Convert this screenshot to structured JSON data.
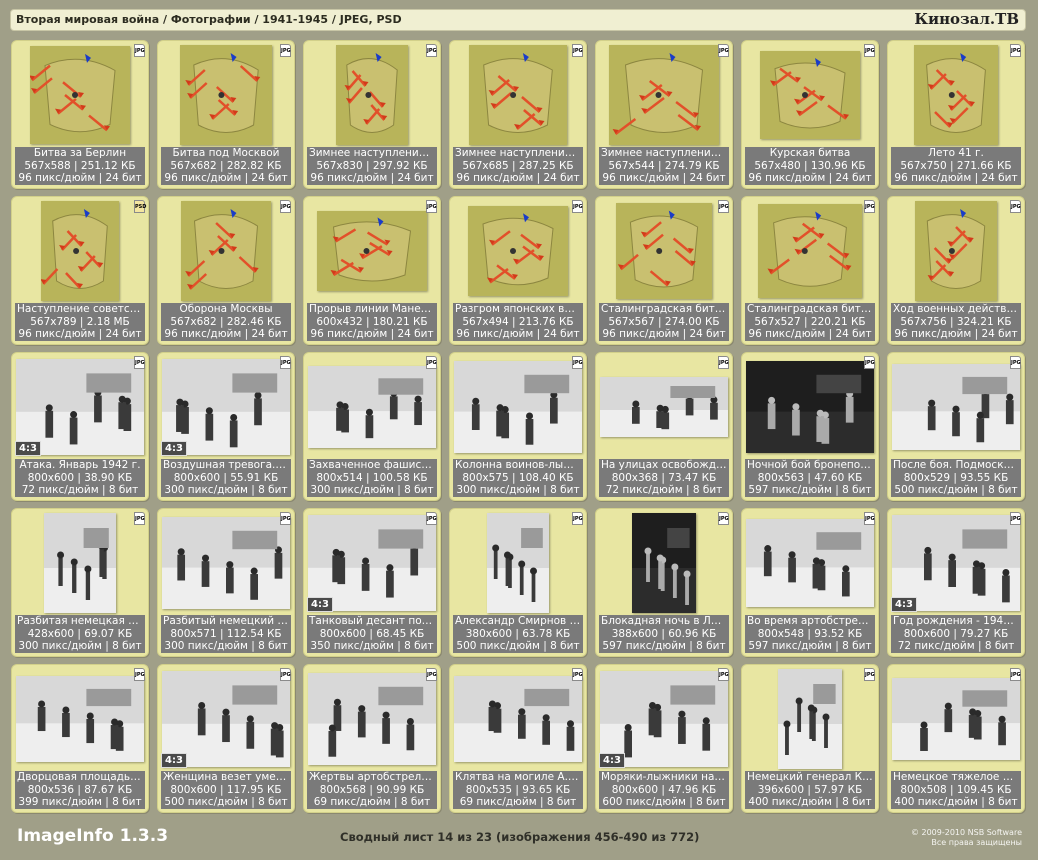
{
  "header": {
    "breadcrumb": "Вторая мировая война / Фотографии / 1941-1945 / JPEG, PSD",
    "brand": "Кинозал.ТВ"
  },
  "items": [
    {
      "title": "Битва за Берлин",
      "dims": "567x588 | 251.12 КБ",
      "res": "96 пикс/дюйм | 24 бит",
      "type": "JPG",
      "kind": "map",
      "ratio": ""
    },
    {
      "title": "Битва под Москвой",
      "dims": "567x682 | 282.82 КБ",
      "res": "96 пикс/дюйм | 24 бит",
      "type": "JPG",
      "kind": "map",
      "ratio": ""
    },
    {
      "title": "Зимнее наступление 4...",
      "dims": "567x830 | 297.92 КБ",
      "res": "96 пикс/дюйм | 24 бит",
      "type": "JPG",
      "kind": "map",
      "ratio": ""
    },
    {
      "title": "Зимнее наступление 4...",
      "dims": "567x685 | 287.25 КБ",
      "res": "96 пикс/дюйм | 24 бит",
      "type": "JPG",
      "kind": "map",
      "ratio": ""
    },
    {
      "title": "Зимнее наступление 45 г",
      "dims": "567x544 | 274.79 КБ",
      "res": "96 пикс/дюйм | 24 бит",
      "type": "JPG",
      "kind": "map",
      "ratio": ""
    },
    {
      "title": "Курская битва",
      "dims": "567x480 | 130.96 КБ",
      "res": "96 пикс/дюйм | 24 бит",
      "type": "JPG",
      "kind": "map",
      "ratio": ""
    },
    {
      "title": "Лето 41 г.",
      "dims": "567x750 | 271.66 КБ",
      "res": "96 пикс/дюйм | 24 бит",
      "type": "JPG",
      "kind": "map",
      "ratio": ""
    },
    {
      "title": "Наступление советск...",
      "dims": "567x789 | 2.18 МБ",
      "res": "96 пикс/дюйм | 24 бит",
      "type": "PSD",
      "kind": "map",
      "ratio": ""
    },
    {
      "title": "Оборона Москвы",
      "dims": "567x682 | 282.46 КБ",
      "res": "96 пикс/дюйм | 24 бит",
      "type": "JPG",
      "kind": "map",
      "ratio": ""
    },
    {
      "title": "Прорыв линии Манерг...",
      "dims": "600x432 | 180.21 КБ",
      "res": "96 пикс/дюйм | 24 бит",
      "type": "JPG",
      "kind": "map",
      "ratio": ""
    },
    {
      "title": "Разгром японских вой...",
      "dims": "567x494 | 213.76 КБ",
      "res": "96 пикс/дюйм | 24 бит",
      "type": "JPG",
      "kind": "map",
      "ratio": ""
    },
    {
      "title": "Сталинградская битв...",
      "dims": "567x567 | 274.00 КБ",
      "res": "96 пикс/дюйм | 24 бит",
      "type": "JPG",
      "kind": "map",
      "ratio": ""
    },
    {
      "title": "Сталинградская битв...",
      "dims": "567x527 | 220.21 КБ",
      "res": "96 пикс/дюйм | 24 бит",
      "type": "JPG",
      "kind": "map",
      "ratio": ""
    },
    {
      "title": "Ход военных действи...",
      "dims": "567x756 | 324.21 КБ",
      "res": "96 пикс/дюйм | 24 бит",
      "type": "JPG",
      "kind": "map",
      "ratio": ""
    },
    {
      "title": "Атака. Январь 1942 г.",
      "dims": "800x600 | 38.90 КБ",
      "res": "72 пикс/дюйм | 8 бит",
      "type": "JPG",
      "kind": "photo",
      "ratio": "4:3"
    },
    {
      "title": "Воздушная тревога. А...",
      "dims": "800x600 | 55.91 КБ",
      "res": "300 пикс/дюйм | 8 бит",
      "type": "JPG",
      "kind": "photo",
      "ratio": "4:3"
    },
    {
      "title": "Захваченное фашистс...",
      "dims": "800x514 | 100.58 КБ",
      "res": "300 пикс/дюйм | 8 бит",
      "type": "JPG",
      "kind": "photo",
      "ratio": ""
    },
    {
      "title": "Колонна воинов-лыжн...",
      "dims": "800x575 | 108.40 КБ",
      "res": "300 пикс/дюйм | 8 бит",
      "type": "JPG",
      "kind": "photo",
      "ratio": ""
    },
    {
      "title": "На улицах освобожде...",
      "dims": "800x368 | 73.47 КБ",
      "res": "72 пикс/дюйм | 8 бит",
      "type": "JPG",
      "kind": "photo",
      "ratio": ""
    },
    {
      "title": "Ночной бой бронепоез...",
      "dims": "800x563 | 47.60 КБ",
      "res": "597 пикс/дюйм | 8 бит",
      "type": "JPG",
      "kind": "photo",
      "ratio": ""
    },
    {
      "title": "После боя. Подмосков...",
      "dims": "800x529 | 93.55 КБ",
      "res": "500 пикс/дюйм | 8 бит",
      "type": "JPG",
      "kind": "photo",
      "ratio": ""
    },
    {
      "title": "Разбитая немецкая пу...",
      "dims": "428x600 | 69.07 КБ",
      "res": "300 пикс/дюйм | 8 бит",
      "type": "JPG",
      "kind": "photo",
      "ratio": ""
    },
    {
      "title": "Разбитый немецкий та...",
      "dims": "800x571 | 112.54 КБ",
      "res": "300 пикс/дюйм | 8 бит",
      "type": "JPG",
      "kind": "photo",
      "ratio": ""
    },
    {
      "title": "Танковый десант под ...",
      "dims": "800x600 | 68.45 КБ",
      "res": "350 пикс/дюйм | 8 бит",
      "type": "JPG",
      "kind": "photo",
      "ratio": "4:3"
    },
    {
      "title": "Александр Смирнов п...",
      "dims": "380x600 | 63.78 КБ",
      "res": "500 пикс/дюйм | 8 бит",
      "type": "JPG",
      "kind": "photo",
      "ratio": ""
    },
    {
      "title": "Блокадная ночь в Лен...",
      "dims": "388x600 | 60.96 КБ",
      "res": "597 пикс/дюйм | 8 бит",
      "type": "JPG",
      "kind": "photo",
      "ratio": ""
    },
    {
      "title": "Во время артобстрела...",
      "dims": "800x548 | 93.52 КБ",
      "res": "597 пикс/дюйм | 8 бит",
      "type": "JPG",
      "kind": "photo",
      "ratio": ""
    },
    {
      "title": "Год рождения - 1942. ...",
      "dims": "800x600 | 79.27 КБ",
      "res": "72 пикс/дюйм | 8 бит",
      "type": "JPG",
      "kind": "photo",
      "ratio": "4:3"
    },
    {
      "title": "Дворцовая площадь. ...",
      "dims": "800x536 | 87.67 КБ",
      "res": "399 пикс/дюйм | 8 бит",
      "type": "JPG",
      "kind": "photo",
      "ratio": ""
    },
    {
      "title": "Женщина везет умер...",
      "dims": "800x600 | 117.95 КБ",
      "res": "500 пикс/дюйм | 8 бит",
      "type": "JPG",
      "kind": "photo",
      "ratio": "4:3"
    },
    {
      "title": "Жертвы артобстрела...",
      "dims": "800x568 | 90.99 КБ",
      "res": "69 пикс/дюйм | 8 бит",
      "type": "JPG",
      "kind": "photo",
      "ratio": ""
    },
    {
      "title": "Клятва на могиле А.В....",
      "dims": "800x535 | 93.65 КБ",
      "res": "69 пикс/дюйм | 8 бит",
      "type": "JPG",
      "kind": "photo",
      "ratio": ""
    },
    {
      "title": "Моряки-лыжники на з...",
      "dims": "800x600 | 47.96 КБ",
      "res": "600 пикс/дюйм | 8 бит",
      "type": "JPG",
      "kind": "photo",
      "ratio": "4:3"
    },
    {
      "title": "Немецкий генерал Кр...",
      "dims": "396x600 | 57.97 КБ",
      "res": "400 пикс/дюйм | 8 бит",
      "type": "JPG",
      "kind": "photo",
      "ratio": ""
    },
    {
      "title": "Немецкое тяжелое ос...",
      "dims": "800x508 | 109.45 КБ",
      "res": "400 пикс/дюйм | 8 бит",
      "type": "JPG",
      "kind": "photo",
      "ratio": ""
    }
  ],
  "footer": {
    "app_name": "ImageInfo 1.3.3",
    "sheet_info": "Сводный лист 14 из 23 (изображения 456-490 из 772)",
    "copyright_line1": "© 2009-2010 NSB Software",
    "copyright_line2": "Все права защищены"
  }
}
